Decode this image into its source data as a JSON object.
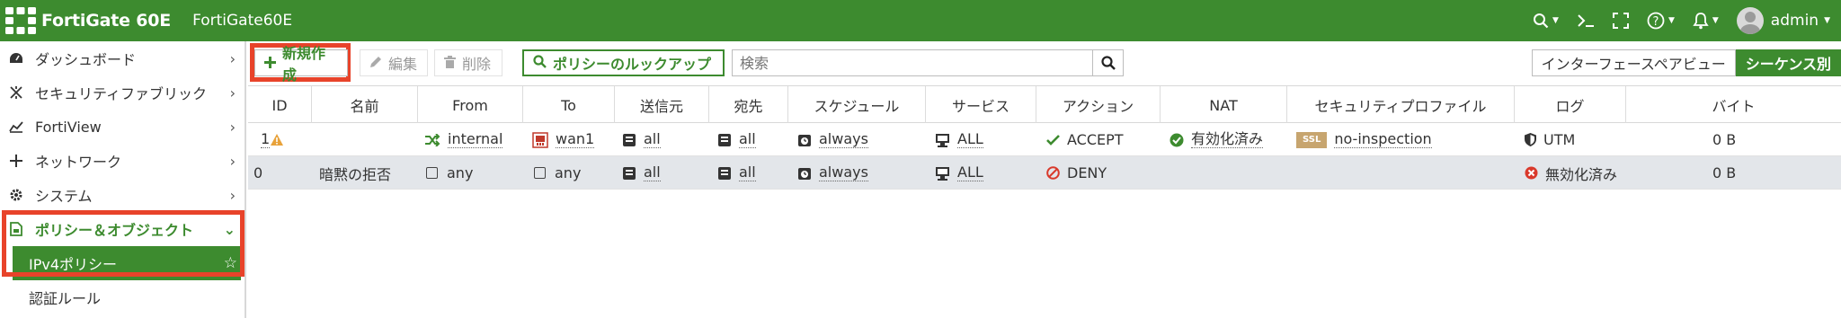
{
  "header": {
    "brand": "FortiGate 60E",
    "hostname": "FortiGate60E",
    "user": "admin"
  },
  "sidebar": {
    "items": [
      {
        "label": "ダッシュボード",
        "icon": "dashboard-icon"
      },
      {
        "label": "セキュリティファブリック",
        "icon": "security-fabric-icon"
      },
      {
        "label": "FortiView",
        "icon": "fortiview-icon"
      },
      {
        "label": "ネットワーク",
        "icon": "network-icon"
      },
      {
        "label": "システム",
        "icon": "gear-icon"
      },
      {
        "label": "ポリシー＆オブジェクト",
        "icon": "policy-icon"
      }
    ],
    "subitems": [
      {
        "label": "IPv4ポリシー",
        "active": true
      },
      {
        "label": "認証ルール",
        "active": false
      }
    ]
  },
  "toolbar": {
    "new_label": "新規作成",
    "edit_label": "編集",
    "delete_label": "削除",
    "lookup_label": "ポリシーのルックアップ",
    "search_placeholder": "検索",
    "view_interface_pair": "インターフェースペアビュー",
    "view_sequence": "シーケンス別"
  },
  "table": {
    "columns": [
      "ID",
      "名前",
      "From",
      "To",
      "送信元",
      "宛先",
      "スケジュール",
      "サービス",
      "アクション",
      "NAT",
      "セキュリティプロファイル",
      "ログ",
      "バイト"
    ],
    "rows": [
      {
        "id": "1",
        "name": "",
        "from": "internal",
        "to": "wan1",
        "src": "all",
        "dst": "all",
        "schedule": "always",
        "service": "ALL",
        "action": "ACCEPT",
        "nat": "有効化済み",
        "profile_badge": "SSL",
        "profile": "no-inspection",
        "log": "UTM",
        "bytes": "0 B"
      },
      {
        "id": "0",
        "name": "暗黙の拒否",
        "from": "any",
        "to": "any",
        "src": "all",
        "dst": "all",
        "schedule": "always",
        "service": "ALL",
        "action": "DENY",
        "nat": "",
        "profile_badge": "",
        "profile": "",
        "log": "無効化済み",
        "bytes": "0 B"
      }
    ]
  },
  "colors": {
    "brand_green": "#3d8b2f",
    "highlight_red": "#e8432a",
    "deny_red": "#d9392b",
    "ssl_badge": "#c7a56f"
  }
}
